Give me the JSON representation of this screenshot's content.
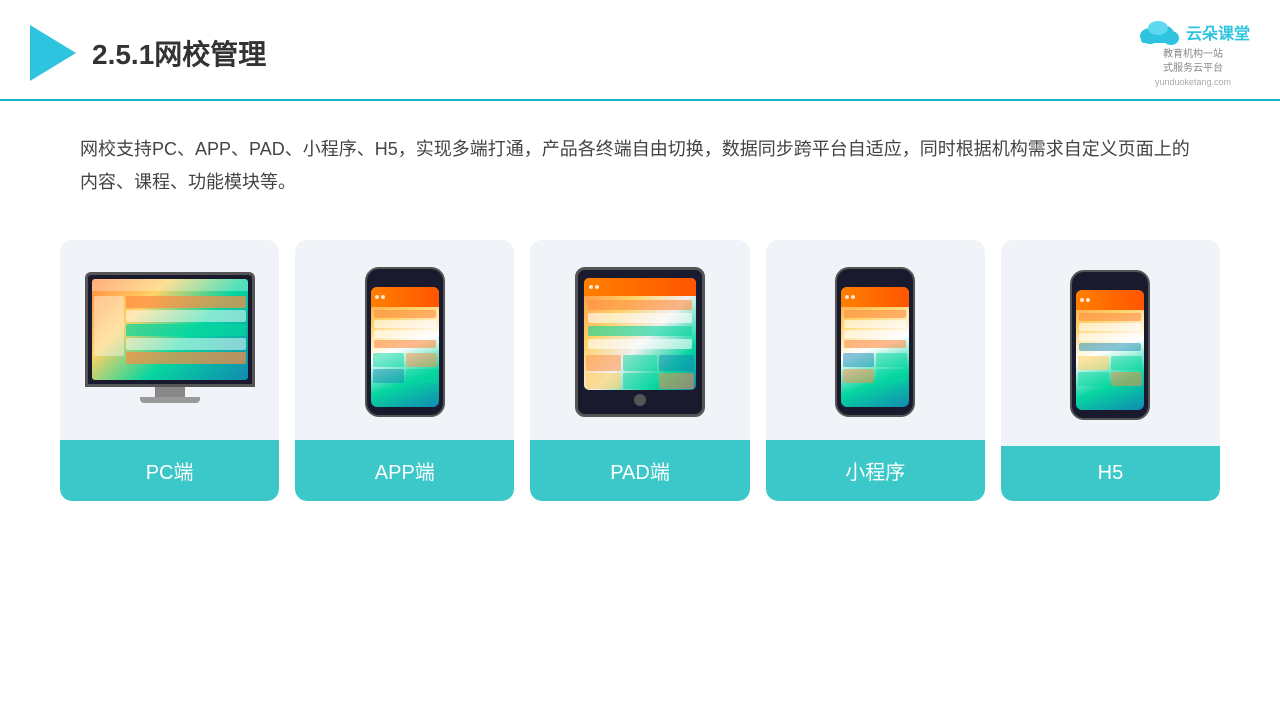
{
  "header": {
    "title": "2.5.1网校管理",
    "brand": {
      "name": "云朵课堂",
      "url": "yunduoketang.com",
      "sub_line1": "教育机构一站",
      "sub_line2": "式服务云平台"
    }
  },
  "description": {
    "text": "网校支持PC、APP、PAD、小程序、H5，实现多端打通，产品各终端自由切换，数据同步跨平台自适应，同时根据机构需求自定义页面上的内容、课程、功能模块等。"
  },
  "cards": [
    {
      "id": "pc",
      "label": "PC端",
      "type": "pc"
    },
    {
      "id": "app",
      "label": "APP端",
      "type": "phone"
    },
    {
      "id": "pad",
      "label": "PAD端",
      "type": "tablet"
    },
    {
      "id": "mini",
      "label": "小程序",
      "type": "phone"
    },
    {
      "id": "h5",
      "label": "H5",
      "type": "phone"
    }
  ],
  "colors": {
    "accent": "#2ec4e0",
    "card_label_bg": "#3cc8c8",
    "card_bg": "#eef2f7"
  }
}
